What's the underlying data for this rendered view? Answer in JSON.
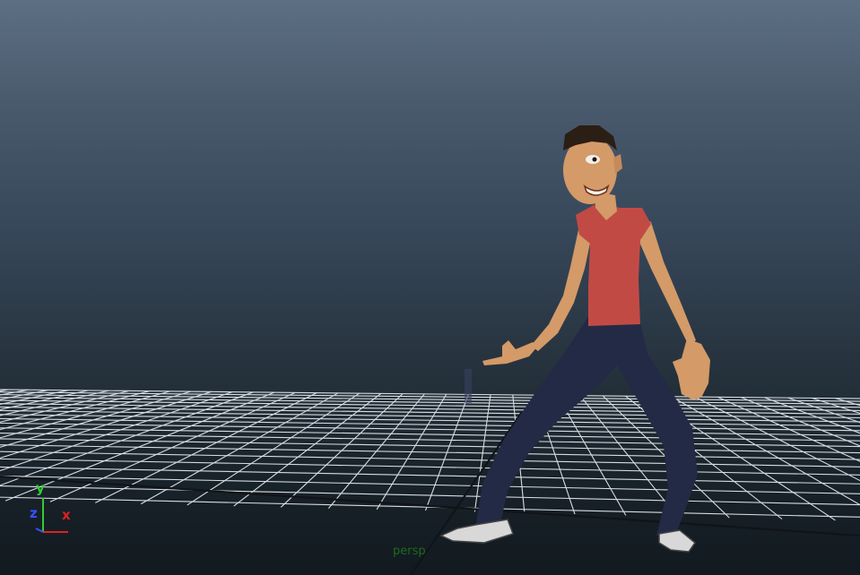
{
  "viewport": {
    "camera_name": "persp",
    "background_top": "#5c6f83",
    "background_bottom": "#121a20",
    "grid_color": "#d8dde2"
  },
  "axis_gizmo": {
    "y_label": "y",
    "z_label": "z",
    "x_label": "x",
    "y_color": "#33cc33",
    "z_color": "#3355ff",
    "x_color": "#dd2222"
  },
  "character": {
    "shirt_color": "#c24a45",
    "pants_color": "#232a45",
    "skin_color": "#d49a68",
    "hair_color": "#2b1e14",
    "shoe_color": "#d8d8d8"
  }
}
